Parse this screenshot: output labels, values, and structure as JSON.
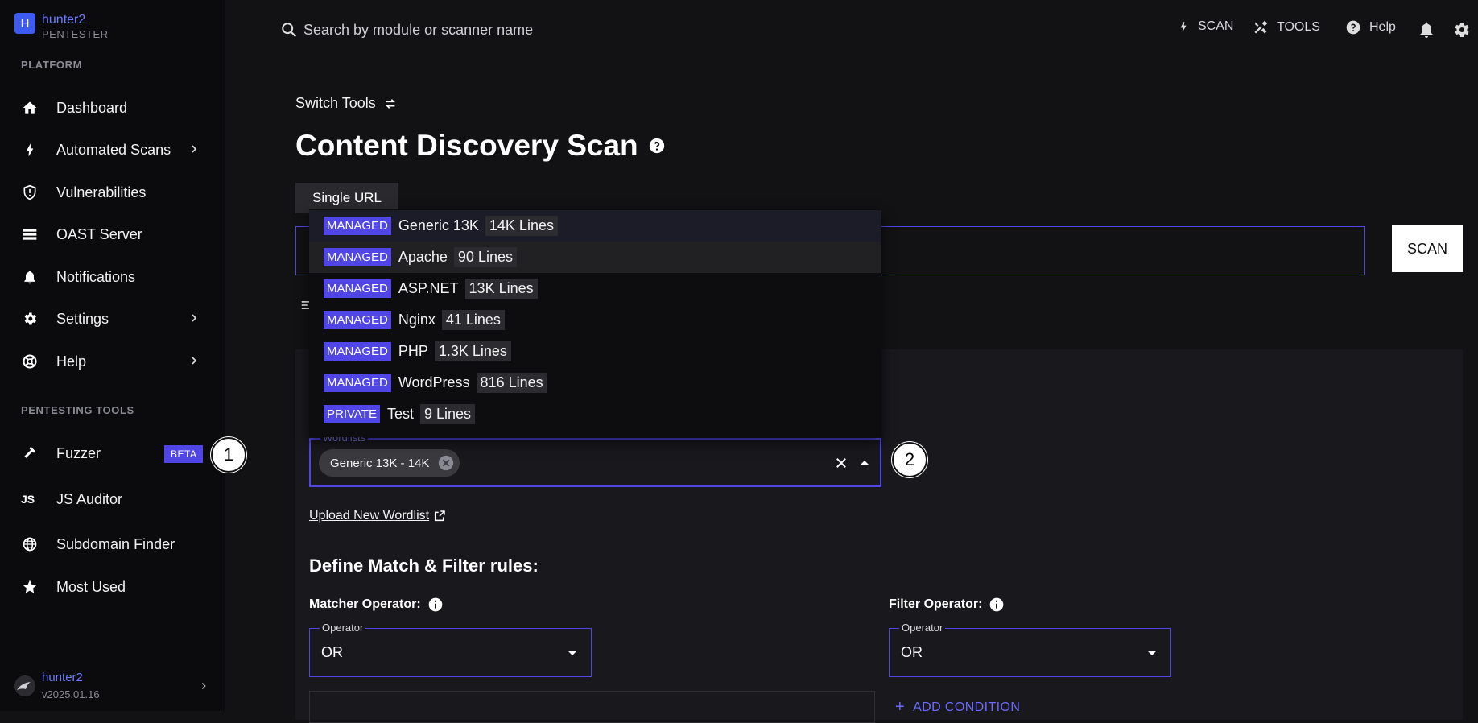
{
  "colors": {
    "accent": "#4f46e5",
    "brand": "#3d5af1",
    "link": "#6b7cff"
  },
  "brand": {
    "initial": "H",
    "name": "hunter2",
    "role": "PENTESTER"
  },
  "sidebar": {
    "platform_title": "PLATFORM",
    "platform_items": [
      {
        "label": "Dashboard",
        "icon": "home-icon"
      },
      {
        "label": "Automated Scans",
        "icon": "bolt-icon",
        "has_submenu": true
      },
      {
        "label": "Vulnerabilities",
        "icon": "shield-icon"
      },
      {
        "label": "OAST Server",
        "icon": "server-icon"
      },
      {
        "label": "Notifications",
        "icon": "bell-icon"
      },
      {
        "label": "Settings",
        "icon": "gear-icon",
        "has_submenu": true
      },
      {
        "label": "Help",
        "icon": "lifebuoy-icon",
        "has_submenu": true
      }
    ],
    "tools_title": "PENTESTING TOOLS",
    "tools_items": [
      {
        "label": "Fuzzer",
        "icon": "hammer-icon",
        "badge": "BETA"
      },
      {
        "label": "JS Auditor",
        "icon": "js-icon"
      },
      {
        "label": "Subdomain Finder",
        "icon": "globe-icon"
      },
      {
        "label": "Most Used",
        "icon": "star-icon"
      }
    ]
  },
  "user": {
    "name": "hunter2",
    "version": "v2025.01.16"
  },
  "topbar": {
    "search_placeholder": "Search by module or scanner name",
    "scan_label": "SCAN",
    "tools_label": "TOOLS",
    "help_label": "Help"
  },
  "main": {
    "switch_tools": "Switch Tools",
    "title": "Content Discovery Scan",
    "tab_single_url": "Single URL",
    "scan_button": "SCAN",
    "wordlists_label": "Wordlists",
    "selected_chip": "Generic 13K - 14K",
    "upload_link": "Upload New Wordlist",
    "rules_title": "Define Match & Filter rules:",
    "matcher_label": "Matcher Operator:",
    "filter_label": "Filter Operator:",
    "operator_legend": "Operator",
    "matcher_value": "OR",
    "filter_value": "OR",
    "add_condition": "ADD CONDITION"
  },
  "dropdown": {
    "options": [
      {
        "type": "MANAGED",
        "name": "Generic 13K",
        "lines": "14K Lines"
      },
      {
        "type": "MANAGED",
        "name": "Apache",
        "lines": "90 Lines"
      },
      {
        "type": "MANAGED",
        "name": "ASP.NET",
        "lines": "13K Lines"
      },
      {
        "type": "MANAGED",
        "name": "Nginx",
        "lines": "41 Lines"
      },
      {
        "type": "MANAGED",
        "name": "PHP",
        "lines": "1.3K Lines"
      },
      {
        "type": "MANAGED",
        "name": "WordPress",
        "lines": "816 Lines"
      },
      {
        "type": "PRIVATE",
        "name": "Test",
        "lines": "9 Lines"
      }
    ]
  },
  "annotations": {
    "marker_1": "1",
    "marker_2": "2"
  }
}
